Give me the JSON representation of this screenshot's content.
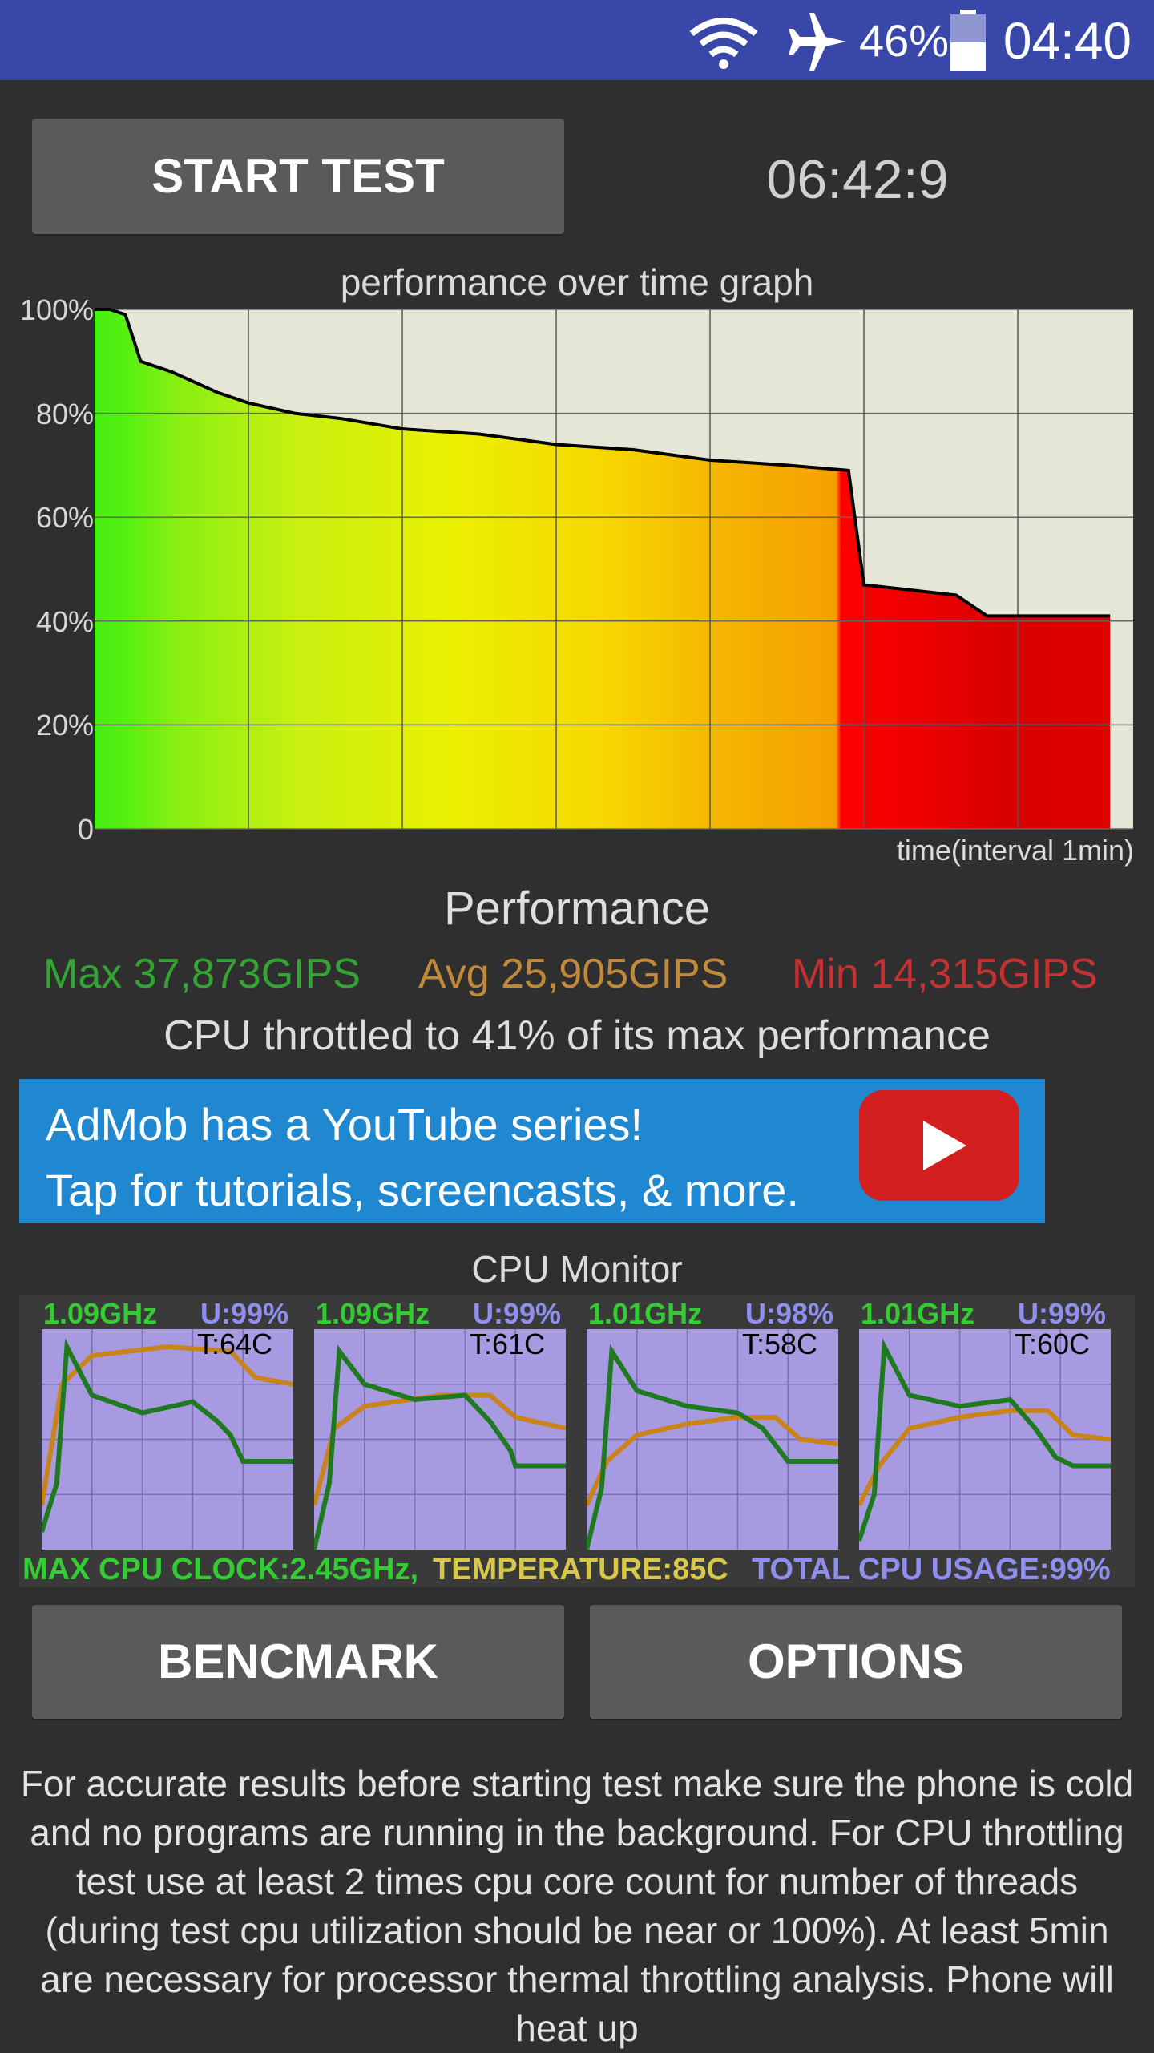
{
  "status_bar": {
    "wifi_icon": "wifi-icon",
    "airplane_icon": "airplane-icon",
    "battery_icon": "battery-icon",
    "battery_percent": "46%",
    "battery_level": 0.46,
    "time": "04:40"
  },
  "controls": {
    "start_test_label": "START TEST",
    "timer": "06:42:9",
    "benchmark_label": "BENCMARK",
    "options_label": "OPTIONS"
  },
  "graph": {
    "title": "performance over time graph",
    "y_ticks": [
      "100%",
      "80%",
      "60%",
      "40%",
      "20%",
      "0"
    ],
    "x_caption": "time(interval 1min)"
  },
  "chart_data": [
    {
      "type": "area",
      "title": "performance over time graph",
      "xlabel": "time(interval 1min)",
      "ylabel": "",
      "ylim": [
        0,
        100
      ],
      "grid": true,
      "x_gridline_interval_minutes": 1,
      "x": [
        0,
        0.1,
        0.2,
        0.3,
        0.5,
        0.8,
        1.0,
        1.3,
        1.6,
        2.0,
        2.5,
        3.0,
        3.5,
        4.0,
        4.5,
        4.9,
        5.0,
        5.3,
        5.6,
        5.8,
        6.0,
        6.3,
        6.6
      ],
      "series": [
        {
          "name": "",
          "values": [
            100,
            100,
            99,
            90,
            88,
            84,
            82,
            80,
            79,
            77,
            76,
            74,
            73,
            71,
            70,
            69,
            47,
            46,
            45,
            41,
            41,
            41,
            41
          ]
        }
      ]
    }
  ],
  "performance": {
    "title": "Performance",
    "max": "Max 37,873GIPS",
    "avg": "Avg 25,905GIPS",
    "min": "Min 14,315GIPS",
    "throttled": "CPU throttled to 41% of its max performance",
    "colors": {
      "max": "#33a533",
      "avg": "#c08a3a",
      "min": "#c43232"
    }
  },
  "ad": {
    "line1": "AdMob has a YouTube series!",
    "line2": "Tap for tutorials, screencasts, & more.",
    "icon": "youtube-play-icon"
  },
  "cpu_monitor": {
    "title": "CPU Monitor",
    "cores": [
      {
        "freq": "1.09GHz",
        "usage": "U:99%",
        "temp": "T:64C"
      },
      {
        "freq": "1.09GHz",
        "usage": "U:99%",
        "temp": "T:61C"
      },
      {
        "freq": "1.01GHz",
        "usage": "U:98%",
        "temp": "T:58C"
      },
      {
        "freq": "1.01GHz",
        "usage": "U:99%",
        "temp": "T:60C"
      }
    ],
    "max_clock": "MAX CPU CLOCK:2.45GHz,",
    "temperature": "TEMPERATURE:85C",
    "total_usage": "TOTAL CPU USAGE:99%",
    "colors": {
      "freq": "#33cc33",
      "temp_line": "#c8841a",
      "usage": "#8f8ff0",
      "background": "#a89ae0"
    }
  },
  "info_text": "For accurate results before starting test make sure the phone is cold and no programs are running in the background. For CPU throttling test use at least 2 times cpu core count for number of threads (during test cpu utilization should be near or 100%). At least 5min are necessary for processor thermal throttling analysis. Phone will heat up"
}
